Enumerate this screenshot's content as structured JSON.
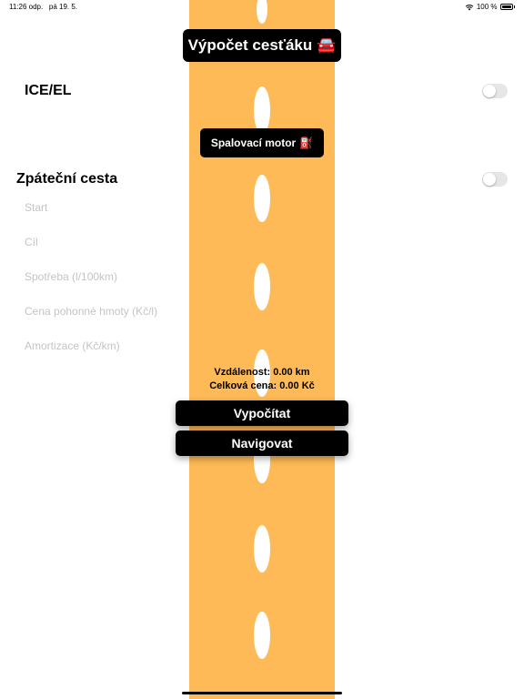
{
  "status_bar": {
    "time": "11:26 odp.",
    "date": "pá 19. 5.",
    "battery": "100 %"
  },
  "header": {
    "title": "Výpočet cesťáku",
    "car_emoji": "🚘"
  },
  "ice_el": {
    "label": "ICE/EL",
    "toggle_on": false
  },
  "engine": {
    "label": "Spalovací motor",
    "fuel_emoji": "⛽"
  },
  "return_trip": {
    "label": "Zpáteční cesta",
    "toggle_on": false
  },
  "form": {
    "start_placeholder": "Start",
    "start_value": "",
    "destination_placeholder": "Cíl",
    "destination_value": "",
    "consumption_placeholder": "Spotřeba (l/100km)",
    "consumption_value": "",
    "fuel_price_placeholder": "Cena pohonné hmoty (Kč/l)",
    "fuel_price_value": "",
    "amortization_placeholder": "Amortizace (Kč/km)",
    "amortization_value": ""
  },
  "results": {
    "distance": "Vzdálenost: 0.00 km",
    "total_price": "Celková cena: 0.00 Kč"
  },
  "buttons": {
    "calculate": "Vypočítat",
    "navigate": "Navigovat"
  },
  "colors": {
    "road": "#fdba57",
    "lane_marking": "#ffffff",
    "pill_background": "#000000",
    "toggle_off": "#e6e6e6"
  }
}
